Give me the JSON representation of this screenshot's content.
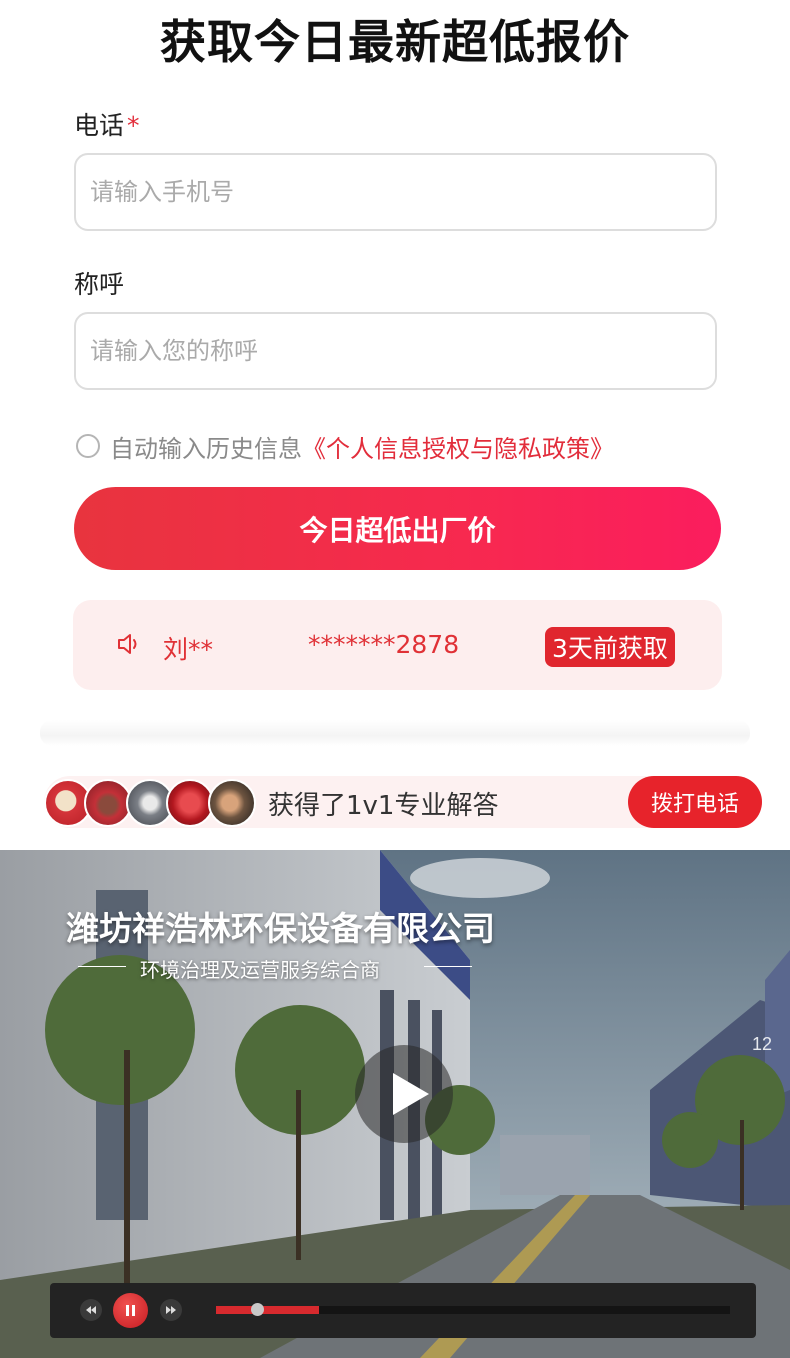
{
  "form": {
    "title": "获取今日最新超低报价",
    "phone_label": "电话",
    "required_mark": "*",
    "phone_placeholder": "请输入手机号",
    "name_label": "称呼",
    "name_placeholder": "请输入您的称呼",
    "auto_fill_text": "自动输入历史信息",
    "policy_link": "《个人信息授权与隐私政策》",
    "submit_label": "今日超低出厂价"
  },
  "ticker": {
    "name": "刘**",
    "phone": "*******2878",
    "badge": "3天前获取"
  },
  "consult_bar": {
    "text": "获得了1v1专业解答",
    "call_button": "拨打电话"
  },
  "video": {
    "company": "潍坊祥浩林环保设备有限公司",
    "slogan": "环境治理及运营服务综合商",
    "progress": 0.2
  },
  "colors": {
    "brand_red": "#e22d3b",
    "ticker_bg": "#fdeeee"
  }
}
